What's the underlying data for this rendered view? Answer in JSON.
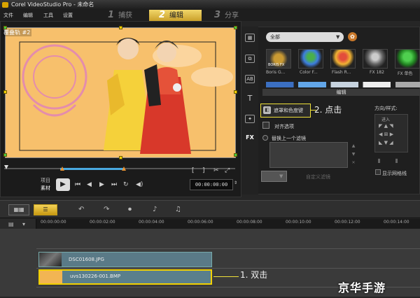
{
  "titlebar": {
    "title": "Corel VideoStudio Pro - 未命名"
  },
  "menu": {
    "items": [
      "文件",
      "编辑",
      "工具",
      "设置"
    ]
  },
  "steps": [
    {
      "num": "1",
      "label": "捕获"
    },
    {
      "num": "2",
      "label": "编辑"
    },
    {
      "num": "3",
      "label": "分享"
    }
  ],
  "preview": {
    "track_label": "覆叠轨 #2"
  },
  "controls": {
    "project_label": "项目",
    "clip_label": "素材",
    "timecode": "00:00:00:00"
  },
  "library": {
    "dropdown_value": "全部",
    "thumbs": [
      {
        "label": "Boris G..."
      },
      {
        "label": "Color F..."
      },
      {
        "label": "Flash R..."
      },
      {
        "label": "FX 182"
      },
      {
        "label": "FX 单色"
      }
    ],
    "boris_fx_text": "BORIS FX"
  },
  "options": {
    "edit_tab": "编辑",
    "mask_button": "遮罩和色度键",
    "align_option": "对齐选项",
    "replace_filter": "替换上一个滤镜",
    "custom_filter": "自定义滤镜",
    "direction_label": "方向/样式:",
    "enter_label": "进入",
    "show_grid": "显示网格线"
  },
  "annotations": {
    "step2": "2. 点击",
    "step1": "1. 双击"
  },
  "timeline": {
    "ticks": [
      "00:00:00:00",
      "00:00:02:00",
      "00:00:04:00",
      "00:00:06:00",
      "00:00:08:00",
      "00:00:10:00",
      "00:00:12:00",
      "00:00:14:00"
    ],
    "clips": [
      {
        "name": "DSC01608.JPG"
      },
      {
        "name": "uvs130226-001.BMP"
      }
    ]
  },
  "watermark": "京华手游"
}
